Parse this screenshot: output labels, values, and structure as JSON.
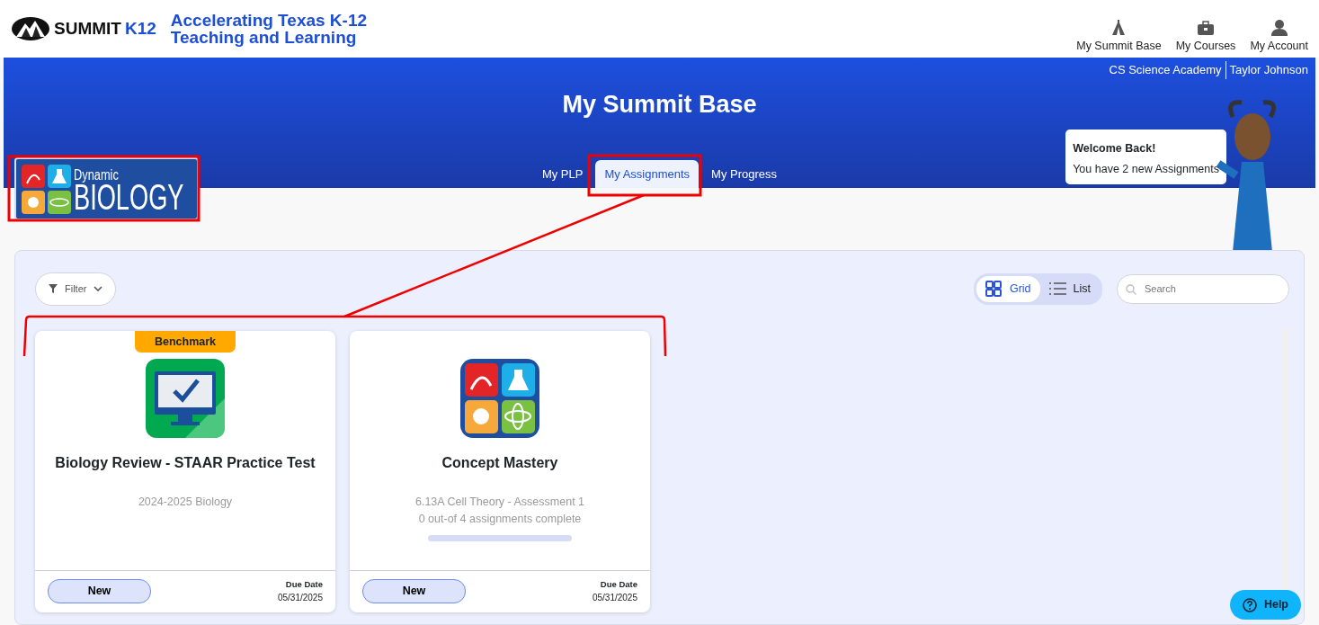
{
  "header": {
    "brand": "SUMMIT",
    "brand_suffix": "K12",
    "tagline": [
      "Accelerating Texas K-12",
      "Teaching and Learning"
    ],
    "nav": [
      {
        "label": "My Summit Base"
      },
      {
        "label": "My Courses"
      },
      {
        "label": "My Account"
      }
    ]
  },
  "banner": {
    "school": "CS Science Academy",
    "user": "Taylor Johnson",
    "title": "My Summit Base",
    "course_logo": {
      "line_1": "Dynamic",
      "line_2": "BIOLOGY"
    },
    "tabs": [
      {
        "label": "My PLP",
        "selected": false
      },
      {
        "label": "My Assignments",
        "selected": true
      },
      {
        "label": "My Progress",
        "selected": false
      }
    ],
    "welcome": {
      "heading": "Welcome Back!",
      "message": "You have 2 new Assignments"
    }
  },
  "toolbar": {
    "filter": "Filter",
    "views": [
      {
        "label": "Grid",
        "selected": true
      },
      {
        "label": "List",
        "selected": false
      }
    ],
    "search": {
      "placeholder": "Search"
    }
  },
  "cards": [
    {
      "kind": "test",
      "badge": "Benchmark",
      "title": "Biology Review - STAAR Practice Test",
      "lines": [
        "2024-2025 Biology"
      ],
      "status": "New",
      "due_label": "Due Date",
      "due": "05/31/2025"
    },
    {
      "kind": "mastery",
      "title": "Concept Mastery",
      "lines": [
        "6.13A Cell Theory - Assessment 1",
        "0 out-of 4 assignments complete"
      ],
      "level": 0,
      "status": "New",
      "due_label": "Due Date",
      "due": "05/31/2025"
    }
  ],
  "help": "Help"
}
